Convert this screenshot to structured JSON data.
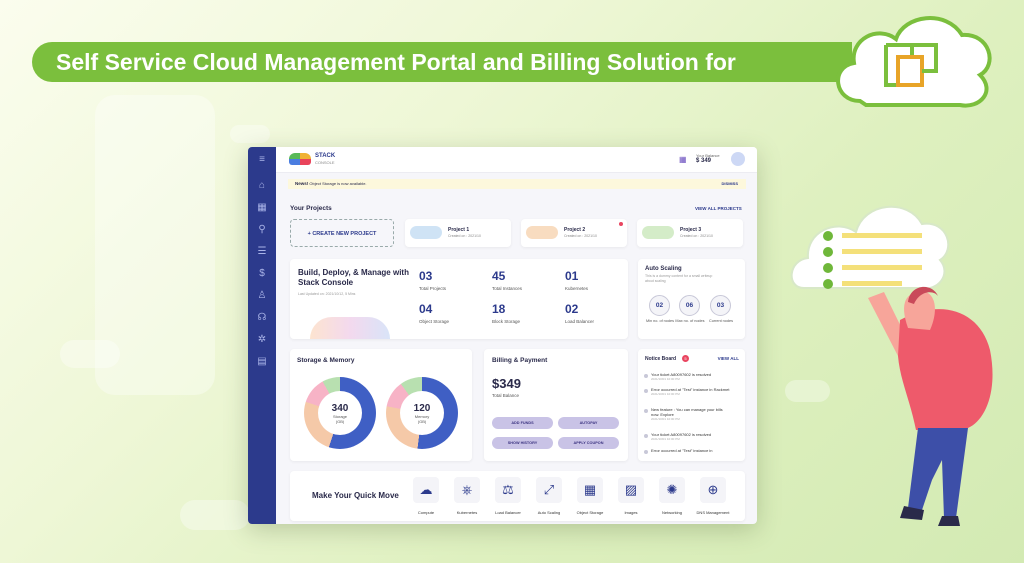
{
  "banner": {
    "title": "Self Service Cloud Management Portal and Billing Solution for"
  },
  "app": {
    "brand": {
      "name": "STACK",
      "sub": "CONSOLE"
    },
    "header": {
      "balance_label": "Your Balance",
      "balance_value": "$ 349"
    },
    "news": {
      "tag": "News!",
      "text": "Object Storage is now available.",
      "dismiss": "DISMISS"
    },
    "projects": {
      "heading": "Your Projects",
      "view_all": "VIEW ALL PROJECTS",
      "create": "+ CREATE NEW PROJECT",
      "items": [
        {
          "name": "Project 1",
          "created": "Created on : 2021/10"
        },
        {
          "name": "Project 2",
          "created": "Created on : 2021/10"
        },
        {
          "name": "Project 3",
          "created": "Created on : 2021/10"
        }
      ]
    },
    "overview": {
      "title": "Build, Deploy, & Manage with Stack Console",
      "updated": "Last Updated on: 2021/10/12, 5 Mins",
      "stats": [
        {
          "value": "03",
          "label": "Total Projects"
        },
        {
          "value": "45",
          "label": "Total Instances"
        },
        {
          "value": "01",
          "label": "Kubernetes"
        },
        {
          "value": "04",
          "label": "Object Storage"
        },
        {
          "value": "18",
          "label": "Block Storage"
        },
        {
          "value": "02",
          "label": "Load Balancer"
        }
      ]
    },
    "autoscaling": {
      "title": "Auto Scaling",
      "subtitle": "This is a dummy content for a small writeup about scaling",
      "items": [
        {
          "value": "02",
          "label": "Min no. of nodes"
        },
        {
          "value": "06",
          "label": "Max no. of nodes"
        },
        {
          "value": "03",
          "label": "Current nodes"
        }
      ]
    },
    "storage": {
      "title": "Storage & Memory",
      "storage_value": "340",
      "storage_label": "Storage",
      "storage_unit": "(GB)",
      "memory_value": "120",
      "memory_label": "Memory",
      "memory_unit": "(GB)"
    },
    "billing": {
      "title": "Billing & Payment",
      "amount": "$349",
      "amount_label": "Total Balance",
      "buttons": [
        "ADD FUNDS",
        "AUTOPAY",
        "SHOW HISTORY",
        "APPLY COUPON"
      ]
    },
    "notice": {
      "title": "Notice Board",
      "badge": "5",
      "view_all": "VIEW ALL",
      "items": [
        {
          "text": "Your ticket A80097602 is resolved",
          "time": "2021/10/01 10:00 PM"
        },
        {
          "text": "Error occurred at \"Test\" instance in Rackmet",
          "time": "2021/10/01 10:00 PM"
        },
        {
          "text": "New feature : You can manage your bills now. Explore",
          "time": "2021/10/01 10:00 PM"
        },
        {
          "text": "Your ticket A80097602 is resolved",
          "time": "2021/10/01 10:00 PM"
        },
        {
          "text": "Error occurred at \"Test\" instance in",
          "time": ""
        }
      ]
    },
    "quick_move": {
      "title": "Make Your Quick Move",
      "items": [
        {
          "label": "Compute",
          "icon": "☁"
        },
        {
          "label": "Kubernetes",
          "icon": "⎈"
        },
        {
          "label": "Load Balancer",
          "icon": "⚖"
        },
        {
          "label": "Auto Scaling",
          "icon": "⤢"
        },
        {
          "label": "Object Storage",
          "icon": "▦"
        },
        {
          "label": "Images",
          "icon": "▨"
        },
        {
          "label": "Networking",
          "icon": "✺"
        },
        {
          "label": "DNS Management",
          "icon": "⊕"
        }
      ]
    },
    "sidebar_icons": [
      "menu-icon",
      "home-icon",
      "apps-icon",
      "network-icon",
      "database-icon",
      "billing-icon",
      "user-icon",
      "support-icon",
      "settings-icon",
      "document-icon"
    ]
  },
  "colors": {
    "banner": "#7bbf3d",
    "sidebar": "#2c3a8c",
    "accent": "#2c3a8c",
    "donut_blue": "#3f5fc4"
  }
}
